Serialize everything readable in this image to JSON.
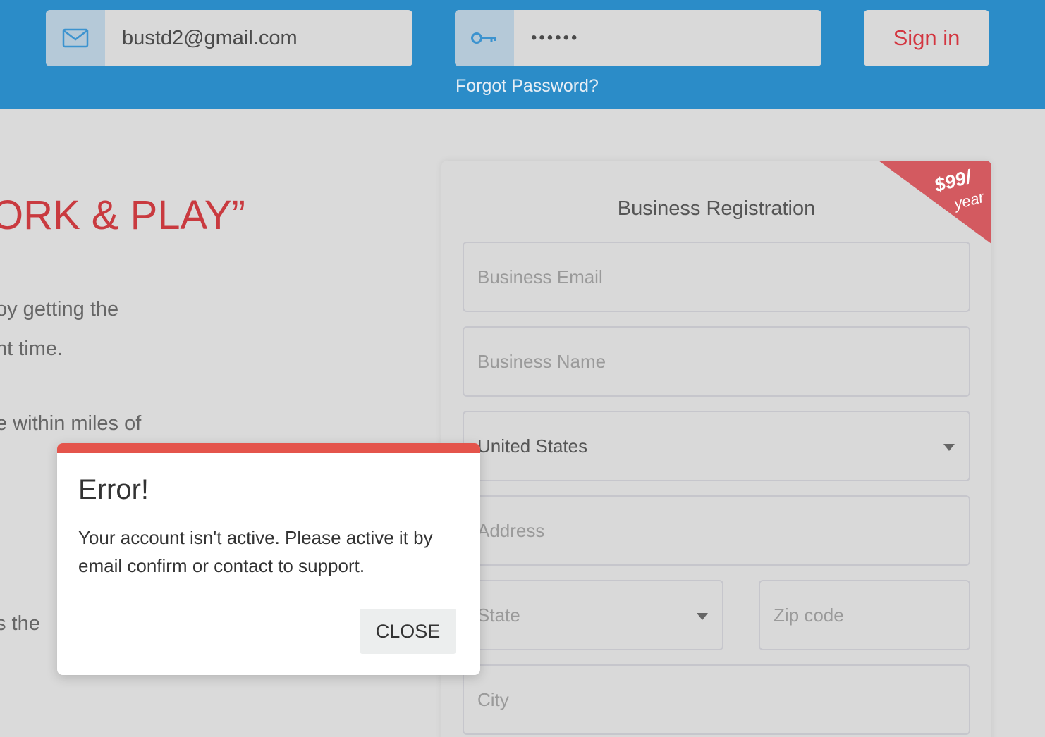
{
  "header": {
    "email_value": "bustd2@gmail.com",
    "password_value": "••••••",
    "signin_label": "Sign in",
    "forgot_label": "Forgot Password?"
  },
  "hero": {
    "title": "ORK & PLAY”",
    "lines": [
      "oy getting the",
      "ht time.",
      "e within miles of",
      "s the"
    ]
  },
  "registration": {
    "title": "Business Registration",
    "price": "$99/",
    "period": "year",
    "email_placeholder": "Business Email",
    "name_placeholder": "Business Name",
    "country_value": "United States",
    "address_placeholder": "Address",
    "state_placeholder": "State",
    "zip_placeholder": "Zip code",
    "city_placeholder": "City"
  },
  "modal": {
    "title": "Error!",
    "message": "Your account isn't active. Please active it by email confirm or contact to support.",
    "close_label": "CLOSE"
  },
  "colors": {
    "topbar": "#2b8cc8",
    "accent_red": "#d3353f",
    "ribbon": "#d35a60",
    "modal_bar": "#e4544b"
  }
}
